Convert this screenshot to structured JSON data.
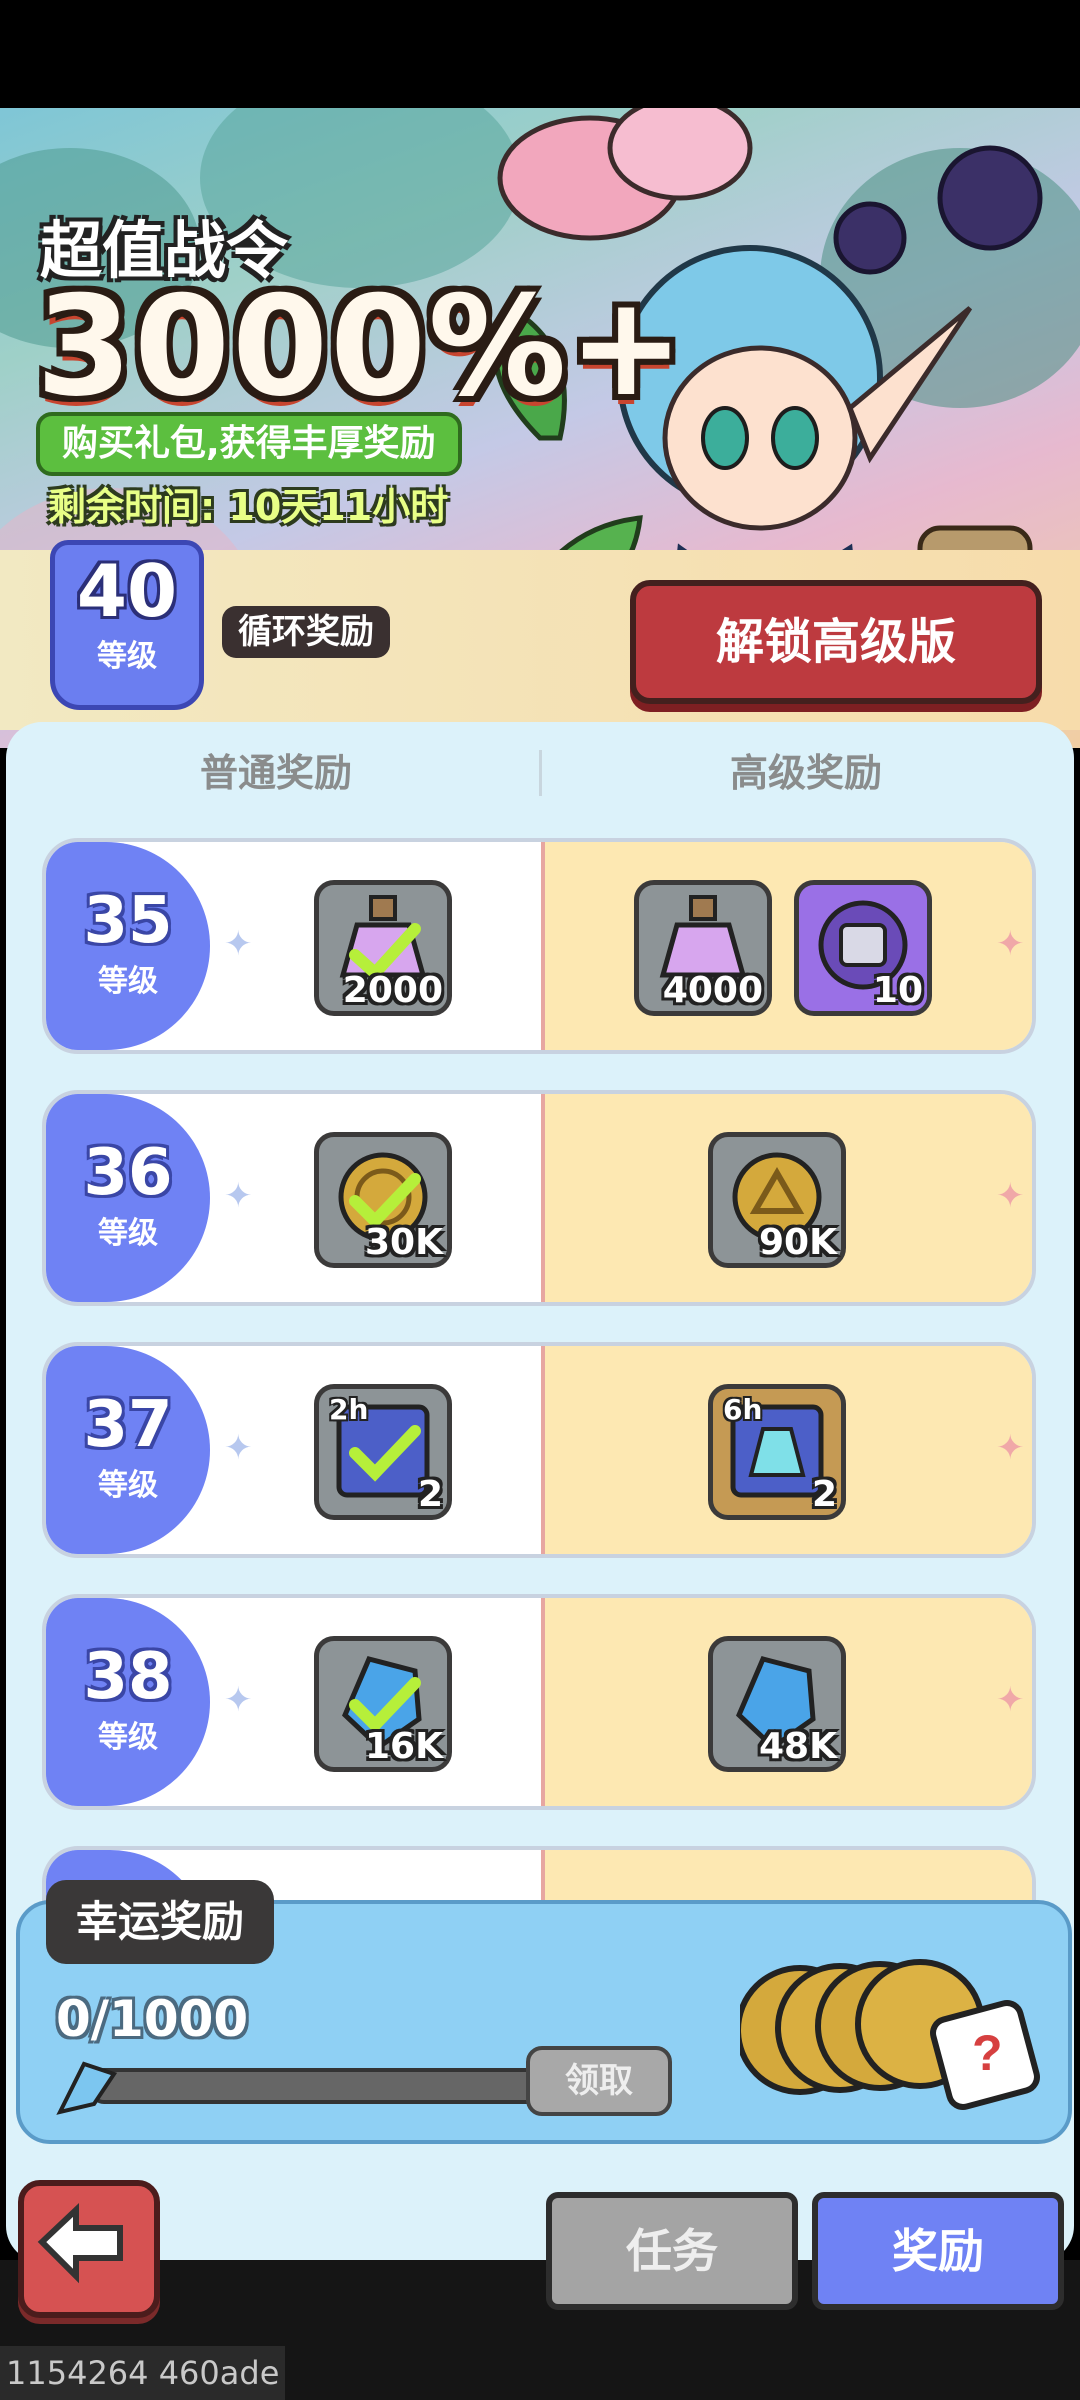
{
  "banner": {
    "title_small": "超值战令",
    "title_big": "3000%+",
    "promo": "购买礼包,获得丰厚奖励",
    "time_remaining": "剩余时间: 10天11小时"
  },
  "header": {
    "level_number": "40",
    "level_label": "等级",
    "cycle_reward": "循环奖励",
    "unlock_button": "解锁高级版"
  },
  "columns": {
    "normal": "普通奖励",
    "premium": "高级奖励"
  },
  "rows": [
    {
      "level": "35",
      "level_label": "等级",
      "normal_qty": "2000",
      "premium_qty_1": "4000",
      "premium_qty_2": "10"
    },
    {
      "level": "36",
      "level_label": "等级",
      "normal_qty": "30K",
      "premium_qty_1": "90K"
    },
    {
      "level": "37",
      "level_label": "等级",
      "normal_qty": "2",
      "normal_tag": "2h",
      "premium_qty_1": "2",
      "premium_tag": "6h"
    },
    {
      "level": "38",
      "level_label": "等级",
      "normal_qty": "16K",
      "premium_qty_1": "48K"
    }
  ],
  "lucky": {
    "title": "幸运奖励",
    "progress_text": "0/1000",
    "progress_fraction": 0,
    "claim_button": "领取"
  },
  "nav": {
    "task_tab": "任务",
    "reward_tab": "奖励"
  },
  "debug_overlay": "1154264 460ade",
  "icons": [
    "back-arrow-icon",
    "potion-icon",
    "coin-icon",
    "crystal-icon",
    "gear-chest-icon",
    "dice-icon",
    "checkmark-icon"
  ]
}
